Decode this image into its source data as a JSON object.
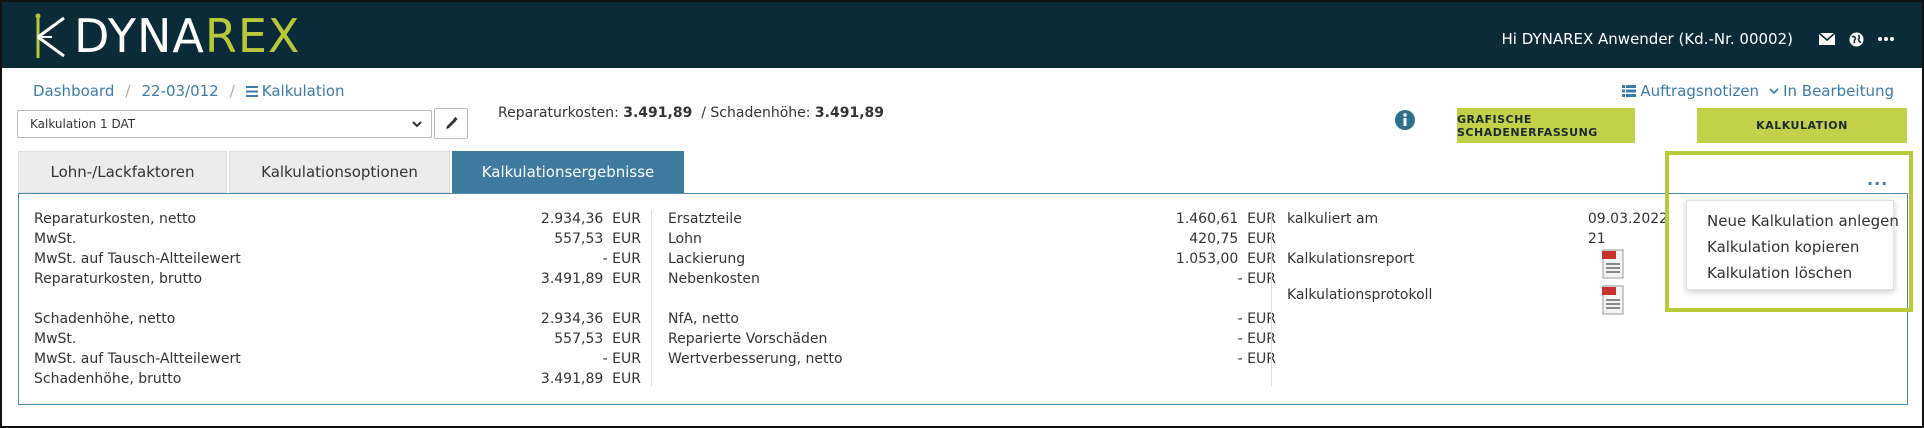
{
  "header": {
    "logo_text_white": "DYNA",
    "logo_text_green": "REX",
    "greeting": "Hi DYNAREX Anwender (Kd.-Nr. 00002)",
    "icons": [
      "mail-icon",
      "globe-icon",
      "more-icon"
    ]
  },
  "breadcrumb": {
    "dashboard": "Dashboard",
    "case": "22-03/012",
    "current": "Kalkulation"
  },
  "calc_select": {
    "value": "Kalkulation 1 DAT"
  },
  "costs": {
    "repair_label": "Reparaturkosten:",
    "repair_value": "3.491,89",
    "damage_label": "/ Schadenhöhe:",
    "damage_value": "3.491,89"
  },
  "topright": {
    "notes": "Auftragsnotizen",
    "status": "In Bearbeitung"
  },
  "buttons": {
    "graphic": "GRAFISCHE SCHADENERFASSUNG",
    "calc": "KALKULATION"
  },
  "tabs": [
    {
      "label": "Lohn-/Lackfaktoren"
    },
    {
      "label": "Kalkulationsoptionen"
    },
    {
      "label": "Kalkulationsergebnisse"
    }
  ],
  "results_left": {
    "group1": [
      {
        "label": "Reparaturkosten, netto",
        "value": "2.934,36",
        "unit": "EUR"
      },
      {
        "label": "MwSt.",
        "value": "557,53",
        "unit": "EUR"
      },
      {
        "label": "MwSt. auf Tausch-Altteilewert",
        "value": "-",
        "unit": "EUR"
      },
      {
        "label": "Reparaturkosten, brutto",
        "value": "3.491,89",
        "unit": "EUR"
      }
    ],
    "group2": [
      {
        "label": "Schadenhöhe, netto",
        "value": "2.934,36",
        "unit": "EUR"
      },
      {
        "label": "MwSt.",
        "value": "557,53",
        "unit": "EUR"
      },
      {
        "label": "MwSt. auf Tausch-Altteilewert",
        "value": "-",
        "unit": "EUR"
      },
      {
        "label": "Schadenhöhe, brutto",
        "value": "3.491,89",
        "unit": "EUR"
      }
    ]
  },
  "results_mid": {
    "group1": [
      {
        "label": "Ersatzteile",
        "value": "1.460,61",
        "unit": "EUR"
      },
      {
        "label": "Lohn",
        "value": "420,75",
        "unit": "EUR"
      },
      {
        "label": "Lackierung",
        "value": "1.053,00",
        "unit": "EUR"
      },
      {
        "label": "Nebenkosten",
        "value": "-",
        "unit": "EUR"
      }
    ],
    "group2": [
      {
        "label": "NfA, netto",
        "value": "-",
        "unit": "EUR"
      },
      {
        "label": "Reparierte Vorschäden",
        "value": "-",
        "unit": "EUR"
      },
      {
        "label": "Wertverbesserung, netto",
        "value": "-",
        "unit": "EUR"
      }
    ]
  },
  "results_right": {
    "calculated_label": "kalkuliert am",
    "calculated_value": "09.03.2022 21",
    "report_label": "Kalkulationsreport",
    "protocol_label": "Kalkulationsprotokoll"
  },
  "more_menu": {
    "dots": "...",
    "items": [
      {
        "label": "Neue Kalkulation anlegen"
      },
      {
        "label": "Kalkulation kopieren"
      },
      {
        "label": "Kalkulation löschen"
      }
    ]
  },
  "colors": {
    "header_bg": "#0b2b38",
    "accent_green": "#c2d04a",
    "link_blue": "#3d7ba8",
    "tab_active": "#3d7ba0"
  }
}
